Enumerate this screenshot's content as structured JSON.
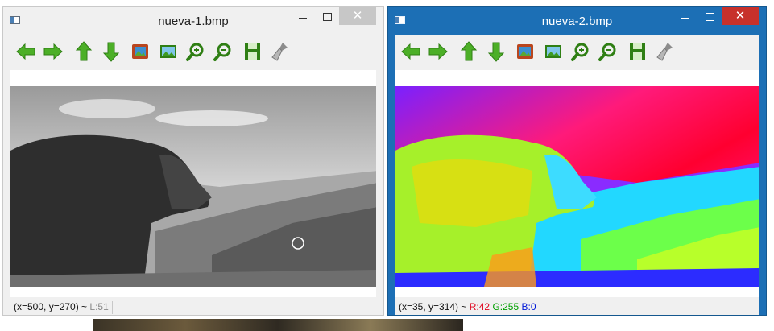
{
  "windows": [
    {
      "title": "nueva-1.bmp",
      "toolbar": [
        "arrow-left-icon",
        "arrow-right-icon",
        "arrow-up-icon",
        "arrow-down-icon",
        "image-icon",
        "fit-image-icon",
        "zoom-in-icon",
        "zoom-out-icon",
        "save-icon",
        "clear-brush-icon"
      ],
      "close_glyph": "✕",
      "status": {
        "coords": "(x=500, y=270) ~ ",
        "lum": "L:51"
      }
    },
    {
      "title": "nueva-2.bmp",
      "close_glyph": "✕",
      "status": {
        "coords": "(x=35, y=314) ~ ",
        "r": "R:42",
        "g": "G:255",
        "b": "B:0"
      }
    }
  ],
  "colors": {
    "active_title": "#1c6fb5",
    "close_active": "#c7312b",
    "close_inactive": "#c7c7c7",
    "toolbar_green": "#4caf27"
  }
}
